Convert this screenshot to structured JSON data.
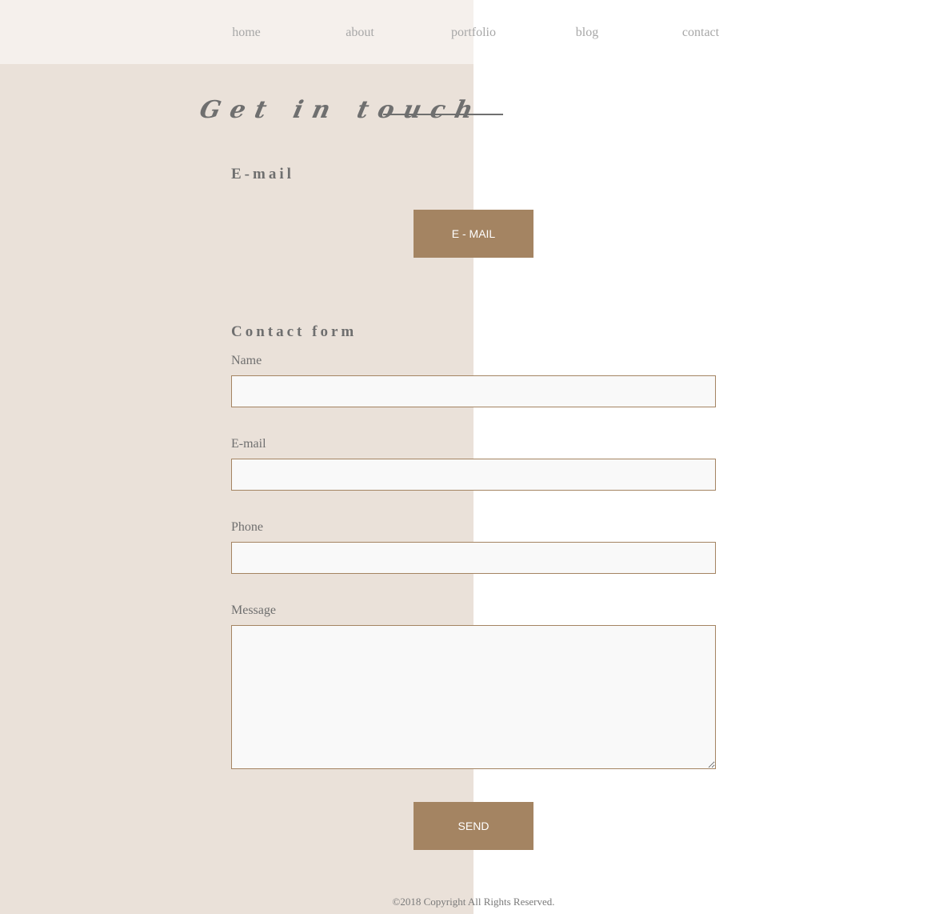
{
  "nav": {
    "items": [
      {
        "label": "home"
      },
      {
        "label": "about"
      },
      {
        "label": "portfolio"
      },
      {
        "label": "blog"
      },
      {
        "label": "contact"
      }
    ]
  },
  "header": {
    "title": "Get in touch"
  },
  "email_section": {
    "heading": "E-mail",
    "button_label": "E - MAIL"
  },
  "contact_form": {
    "heading": "Contact form",
    "fields": [
      {
        "label": "Name",
        "value": ""
      },
      {
        "label": "E-mail",
        "value": ""
      },
      {
        "label": "Phone",
        "value": ""
      },
      {
        "label": "Message",
        "value": ""
      }
    ],
    "submit_label": "SEND"
  },
  "footer": {
    "copyright": "©2018 Copyright All Rights Reserved."
  },
  "colors": {
    "accent": "#a48462",
    "panel": "#eae1d9",
    "nav_panel": "#f5f0ec",
    "text": "#6f6f6f"
  }
}
